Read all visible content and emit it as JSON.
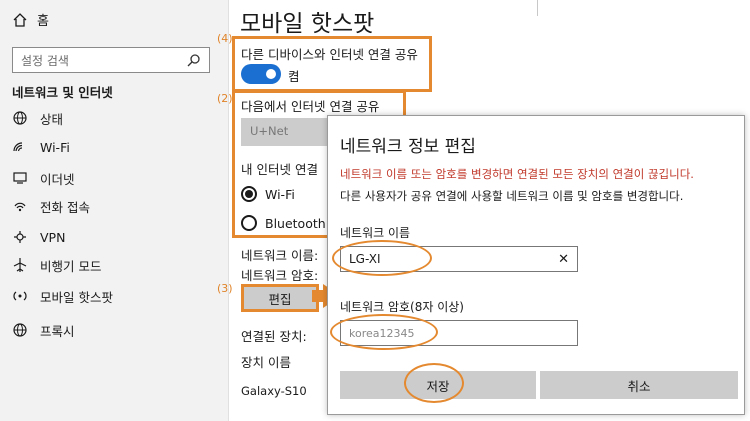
{
  "sidebar": {
    "home": "홈",
    "search_placeholder": "설정 검색",
    "section": "네트워크 및 인터넷",
    "items": [
      {
        "label": "상태",
        "icon": "globe-icon"
      },
      {
        "label": "Wi-Fi",
        "icon": "wifi-icon"
      },
      {
        "label": "이더넷",
        "icon": "ethernet-icon"
      },
      {
        "label": "전화 접속",
        "icon": "dialup-icon"
      },
      {
        "label": "VPN",
        "icon": "vpn-icon"
      },
      {
        "label": "비행기 모드",
        "icon": "airplane-icon"
      },
      {
        "label": "모바일 핫스팟",
        "icon": "hotspot-icon"
      },
      {
        "label": "프록시",
        "icon": "globe-icon"
      }
    ]
  },
  "main": {
    "title": "모바일 핫스팟",
    "markers": {
      "m4": "(4)",
      "m2": "(2)",
      "m3": "(3)"
    },
    "share_label": "다른 디바이스와 인터넷 연결 공유",
    "toggle_state": "켬",
    "from_label": "다음에서 인터넷 연결 공유",
    "from_value": "U+Net",
    "radio_label": "내 인터넷 연결",
    "radio_wifi": "Wi-Fi",
    "radio_bt": "Bluetooth",
    "network_name_label": "네트워크 이름:",
    "network_password_label": "네트워크 암호:",
    "edit_button": "편집",
    "connected_label": "연결된 장치:",
    "device_name_label": "장치 이름",
    "device_1": "Galaxy-S10"
  },
  "dialog": {
    "title": "네트워크 정보 편집",
    "warning": "네트워크 이름 또는 암호를 변경하면 연결된 모든 장치의 연결이 끊깁니다.",
    "description": "다른 사용자가 공유 연결에 사용할 네트워크 이름 및 암호를 변경합니다.",
    "name_label": "네트워크 이름",
    "name_value": "LG-XI",
    "password_label": "네트워크 암호(8자 이상)",
    "password_value": "korea12345",
    "save_button": "저장",
    "cancel_button": "취소"
  },
  "colors": {
    "accent": "#1a6fd0",
    "highlight": "#e4892f",
    "warning": "#c0392b"
  }
}
